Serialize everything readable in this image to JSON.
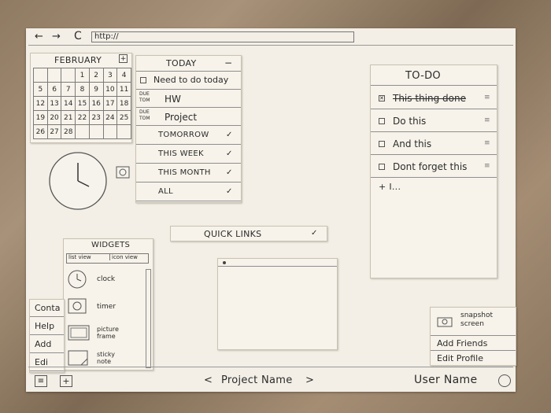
{
  "browser": {
    "back": "←",
    "forward": "→",
    "reload": "C",
    "url": "http://"
  },
  "calendar": {
    "month": "FEBRUARY",
    "add": "+",
    "weeks": [
      [
        "",
        "",
        "",
        "1",
        "2",
        "3",
        "4"
      ],
      [
        "5",
        "6",
        "7",
        "8",
        "9",
        "10",
        "11"
      ],
      [
        "12",
        "13",
        "14",
        "15",
        "16",
        "17",
        "18"
      ],
      [
        "19",
        "20",
        "21",
        "22",
        "23",
        "24",
        "25"
      ],
      [
        "26",
        "27",
        "28",
        "",
        "",
        "",
        ""
      ]
    ]
  },
  "today": {
    "title": "TODAY",
    "collapse": "−",
    "items": [
      {
        "tag": "",
        "text": "Need to do today"
      },
      {
        "tag": "DUE TOM",
        "text": "HW"
      },
      {
        "tag": "DUE TOM",
        "text": "Project"
      }
    ],
    "sections": [
      "TOMORROW",
      "THIS WEEK",
      "THIS MONTH",
      "ALL"
    ],
    "chev": "✓"
  },
  "todo": {
    "title": "TO-DO",
    "items": [
      {
        "text": "This thing done",
        "done": true
      },
      {
        "text": "Do this",
        "done": false
      },
      {
        "text": "And this",
        "done": false
      },
      {
        "text": "Dont forget this",
        "done": false
      }
    ],
    "add": "+ I..."
  },
  "quicklinks": {
    "label": "QUICK LINKS",
    "chev": "✓"
  },
  "widgets": {
    "title": "WIDGETS",
    "tabs": [
      "list view",
      "icon view"
    ],
    "items": [
      "clock",
      "timer",
      "picture frame",
      "sticky note"
    ]
  },
  "leftmenu": [
    "Conta",
    "Help",
    "Add",
    "Edi"
  ],
  "footer": {
    "prev": "<",
    "project": "Project Name",
    "next": ">",
    "user": "User Name"
  },
  "usermenu": {
    "snapshot": "snapshot screen",
    "items": [
      "Add Friends",
      "Edit Profile"
    ]
  }
}
